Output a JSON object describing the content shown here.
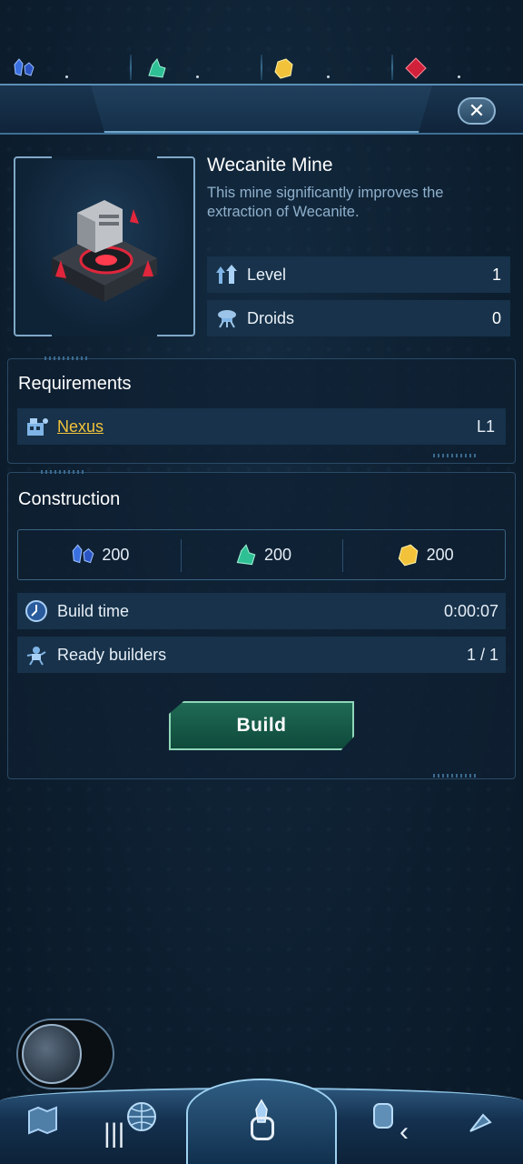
{
  "resources": [
    {
      "name": "wecanite",
      "icon": "blue-crystal-icon",
      "color": "#3a6fe0"
    },
    {
      "name": "green-ore",
      "icon": "green-crystal-icon",
      "color": "#2fbf95"
    },
    {
      "name": "gold",
      "icon": "gold-nugget-icon",
      "color": "#f2c23a"
    },
    {
      "name": "red-gem",
      "icon": "red-gem-icon",
      "color": "#d0203a"
    }
  ],
  "building": {
    "title": "Wecanite Mine",
    "description": "This mine significantly improves the extraction of Wecanite.",
    "stats": [
      {
        "label": "Level",
        "value": "1",
        "icon": "level-arrows-icon"
      },
      {
        "label": "Droids",
        "value": "0",
        "icon": "droid-icon"
      }
    ]
  },
  "requirements": {
    "heading": "Requirements",
    "items": [
      {
        "name": "Nexus",
        "level": "L1",
        "icon": "nexus-icon"
      }
    ]
  },
  "construction": {
    "heading": "Construction",
    "costs": [
      {
        "amount": "200",
        "icon": "blue-crystal-icon"
      },
      {
        "amount": "200",
        "icon": "green-crystal-icon"
      },
      {
        "amount": "200",
        "icon": "gold-nugget-icon"
      }
    ],
    "build_time_label": "Build time",
    "build_time_value": "0:00:07",
    "builders_label": "Ready builders",
    "builders_value": "1 / 1",
    "build_button": "Build"
  },
  "colors": {
    "accent_gold": "#f2c23a",
    "build_green": "#1f6a55"
  }
}
